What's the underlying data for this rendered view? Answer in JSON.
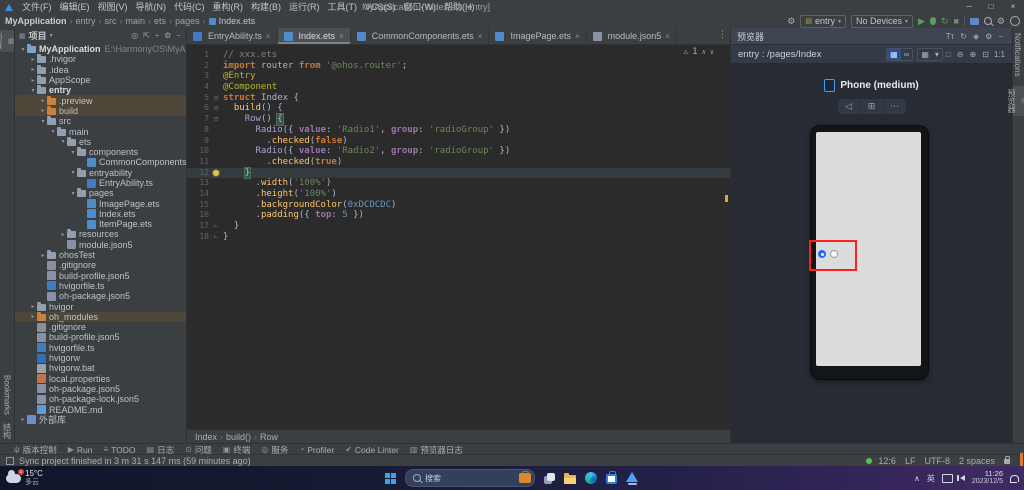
{
  "icons": {
    "min": "─",
    "max": "□",
    "close": "×",
    "settings": "⚙",
    "run": "▶",
    "stop": "■",
    "kebab": "⋮",
    "warning": "⚠",
    "up": "∧",
    "down": "∨",
    "caret": "▾",
    "locate": "◎",
    "collapse": "⇱",
    "divide": "÷",
    "hide": "−",
    "grid": "▦",
    "glasses": "∞"
  },
  "colors": {
    "run_green": "#57a05c",
    "warning_yellow": "#e8a33d",
    "selection_red": "#ff1f1f",
    "radio_checked_blue": "#1f69ff",
    "phone_screen_gray": "#dcdcdc",
    "editor_bg": "#2b2b2b"
  },
  "window": {
    "title": "MyApplication - Index.ets [entry]",
    "menus": [
      "文件(F)",
      "编辑(E)",
      "视图(V)",
      "导航(N)",
      "代码(C)",
      "重构(R)",
      "构建(B)",
      "运行(R)",
      "工具(T)",
      "VCS(S)",
      "窗口(W)",
      "帮助(H)"
    ]
  },
  "toolbar": {
    "breadcrumb": [
      "MyApplication",
      "entry",
      "src",
      "main",
      "ets",
      "pages",
      "Index.ets"
    ],
    "module": "entry",
    "devices": "No Devices"
  },
  "left_stripe": {
    "project": "项目",
    "bookmarks": "Bookmarks",
    "structure": "结构"
  },
  "right_stripe": {
    "notifications": "Notifications",
    "previewer": "预览器"
  },
  "project_panel": {
    "title": "项目",
    "tree": [
      [
        0,
        "v",
        "folder-root",
        "MyApplication",
        "E:\\HarmonyOS\\MyApplicatio",
        "b"
      ],
      [
        1,
        ">",
        "folder",
        ".hvigor",
        "",
        ""
      ],
      [
        1,
        ">",
        "folder",
        ".idea",
        "",
        ""
      ],
      [
        1,
        ">",
        "folder",
        "AppScope",
        "",
        ""
      ],
      [
        1,
        "v",
        "folder",
        "entry",
        "",
        "b"
      ],
      [
        2,
        ">",
        "folder-orange",
        ".preview",
        "",
        "h"
      ],
      [
        2,
        ">",
        "folder-orange",
        "build",
        "",
        "h"
      ],
      [
        2,
        "v",
        "folder",
        "src",
        "",
        ""
      ],
      [
        3,
        "v",
        "folder",
        "main",
        "",
        ""
      ],
      [
        4,
        "v",
        "folder",
        "ets",
        "",
        ""
      ],
      [
        5,
        "v",
        "folder",
        "components",
        "",
        ""
      ],
      [
        6,
        "",
        "ets",
        "CommonComponents.ets",
        "",
        ""
      ],
      [
        5,
        "v",
        "folder",
        "entryability",
        "",
        ""
      ],
      [
        6,
        "",
        "ts",
        "EntryAbility.ts",
        "",
        ""
      ],
      [
        5,
        "v",
        "folder",
        "pages",
        "",
        ""
      ],
      [
        6,
        "",
        "ets",
        "ImagePage.ets",
        "",
        ""
      ],
      [
        6,
        "",
        "ets",
        "Index.ets",
        "",
        ""
      ],
      [
        6,
        "",
        "ets",
        "ItemPage.ets",
        "",
        ""
      ],
      [
        4,
        ">",
        "folder",
        "resources",
        "",
        ""
      ],
      [
        4,
        "",
        "json",
        "module.json5",
        "",
        ""
      ],
      [
        2,
        ">",
        "folder",
        "ohosTest",
        "",
        ""
      ],
      [
        2,
        "",
        "git",
        ".gitignore",
        "",
        ""
      ],
      [
        2,
        "",
        "json",
        "build-profile.json5",
        "",
        ""
      ],
      [
        2,
        "",
        "ts",
        "hvigorfile.ts",
        "",
        ""
      ],
      [
        2,
        "",
        "json",
        "oh-package.json5",
        "",
        ""
      ],
      [
        1,
        ">",
        "folder",
        "hvigor",
        "",
        ""
      ],
      [
        1,
        ">",
        "folder-orange",
        "oh_modules",
        "",
        "h"
      ],
      [
        1,
        "",
        "git",
        ".gitignore",
        "",
        ""
      ],
      [
        1,
        "",
        "json",
        "build-profile.json5",
        "",
        ""
      ],
      [
        1,
        "",
        "ts",
        "hvigorfile.ts",
        "",
        ""
      ],
      [
        1,
        "",
        "file",
        "hvigorw",
        "",
        ""
      ],
      [
        1,
        "",
        "bat",
        "hvigorw.bat",
        "",
        ""
      ],
      [
        1,
        "",
        "props",
        "local.properties",
        "",
        ""
      ],
      [
        1,
        "",
        "json",
        "oh-package.json5",
        "",
        ""
      ],
      [
        1,
        "",
        "json",
        "oh-package-lock.json5",
        "",
        ""
      ],
      [
        1,
        "",
        "md",
        "README.md",
        "",
        ""
      ],
      [
        0,
        ">",
        "lib",
        "外部库",
        "",
        ""
      ]
    ]
  },
  "editor": {
    "tabs": [
      {
        "label": "EntryAbility.ts",
        "type": "ts",
        "active": false
      },
      {
        "label": "Index.ets",
        "type": "ets",
        "active": true
      },
      {
        "label": "CommonComponents.ets",
        "type": "ets",
        "active": false
      },
      {
        "label": "ImagePage.ets",
        "type": "ets",
        "active": false
      },
      {
        "label": "module.json5",
        "type": "json",
        "active": false
      }
    ],
    "warnings": "1",
    "breadcrumb": [
      "Index",
      "build()",
      "Row"
    ],
    "lines": [
      {
        "n": 1,
        "segs": [
          [
            "// xxx.ets",
            "cmt"
          ]
        ]
      },
      {
        "n": 2,
        "segs": [
          [
            "import ",
            "kw"
          ],
          [
            "router ",
            "txt"
          ],
          [
            "from ",
            "kw"
          ],
          [
            "'@ohos.router'",
            "str"
          ],
          [
            ";",
            "txt"
          ]
        ]
      },
      {
        "n": 3,
        "segs": [
          [
            "@Entry",
            "ann"
          ]
        ]
      },
      {
        "n": 4,
        "segs": [
          [
            "@Component",
            "ann"
          ]
        ]
      },
      {
        "n": 5,
        "fold": "s",
        "segs": [
          [
            "struct ",
            "kw"
          ],
          [
            "Index ",
            "txt"
          ],
          [
            "{",
            "txt"
          ]
        ]
      },
      {
        "n": 6,
        "fold": "s",
        "segs": [
          [
            "  ",
            "txt"
          ],
          [
            "build",
            "fn"
          ],
          [
            "() {",
            "txt"
          ]
        ]
      },
      {
        "n": 7,
        "fold": "s",
        "segs": [
          [
            "    ",
            "txt"
          ],
          [
            "Row",
            "cmp"
          ],
          [
            "() ",
            "txt"
          ],
          [
            "{",
            "brace"
          ]
        ]
      },
      {
        "n": 8,
        "segs": [
          [
            "      ",
            "txt"
          ],
          [
            "Radio",
            "cmp"
          ],
          [
            "({ ",
            "txt"
          ],
          [
            "value",
            "key"
          ],
          [
            ": ",
            "txt"
          ],
          [
            "'Radio1'",
            "str"
          ],
          [
            ", ",
            "txt"
          ],
          [
            "group",
            "key"
          ],
          [
            ": ",
            "txt"
          ],
          [
            "'radioGroup'",
            "str"
          ],
          [
            " })",
            "txt"
          ]
        ]
      },
      {
        "n": 9,
        "segs": [
          [
            "        .",
            "txt"
          ],
          [
            "checked",
            "fn"
          ],
          [
            "(",
            "txt"
          ],
          [
            "false",
            "kw"
          ],
          [
            ")",
            "txt"
          ]
        ]
      },
      {
        "n": 10,
        "segs": [
          [
            "      ",
            "txt"
          ],
          [
            "Radio",
            "cmp"
          ],
          [
            "({ ",
            "txt"
          ],
          [
            "value",
            "key"
          ],
          [
            ": ",
            "txt"
          ],
          [
            "'Radio2'",
            "str"
          ],
          [
            ", ",
            "txt"
          ],
          [
            "group",
            "key"
          ],
          [
            ": ",
            "txt"
          ],
          [
            "'radioGroup'",
            "str"
          ],
          [
            " })",
            "txt"
          ]
        ]
      },
      {
        "n": 11,
        "segs": [
          [
            "        .",
            "txt"
          ],
          [
            "checked",
            "fn"
          ],
          [
            "(",
            "txt"
          ],
          [
            "true",
            "kw"
          ],
          [
            ")",
            "txt"
          ]
        ]
      },
      {
        "n": 12,
        "hl": true,
        "bulb": true,
        "fold": "e",
        "segs": [
          [
            "    ",
            "txt"
          ],
          [
            "}",
            "brace"
          ]
        ]
      },
      {
        "n": 13,
        "segs": [
          [
            "      .",
            "txt"
          ],
          [
            "width",
            "fn"
          ],
          [
            "(",
            "txt"
          ],
          [
            "'100%'",
            "str"
          ],
          [
            ")",
            "txt"
          ]
        ]
      },
      {
        "n": 14,
        "segs": [
          [
            "      .",
            "txt"
          ],
          [
            "height",
            "fn"
          ],
          [
            "(",
            "txt"
          ],
          [
            "'100%'",
            "str"
          ],
          [
            ")",
            "txt"
          ]
        ]
      },
      {
        "n": 15,
        "segs": [
          [
            "      .",
            "txt"
          ],
          [
            "backgroundColor",
            "fn"
          ],
          [
            "(",
            "txt"
          ],
          [
            "0xDCDCDC",
            "num2"
          ],
          [
            ")",
            "txt"
          ]
        ]
      },
      {
        "n": 16,
        "segs": [
          [
            "      .",
            "txt"
          ],
          [
            "padding",
            "fn"
          ],
          [
            "({ ",
            "txt"
          ],
          [
            "top",
            "key"
          ],
          [
            ": ",
            "txt"
          ],
          [
            "5",
            "num2"
          ],
          [
            " })",
            "txt"
          ]
        ]
      },
      {
        "n": 17,
        "fold": "e",
        "segs": [
          [
            "  }",
            "txt"
          ]
        ]
      },
      {
        "n": 18,
        "fold": "e",
        "segs": [
          [
            "}",
            "txt"
          ]
        ]
      }
    ]
  },
  "previewer": {
    "title": "预览器",
    "header_icons": [
      "Tт",
      "↻",
      "◈",
      "⚙",
      "−"
    ],
    "target": "entry : /pages/Index",
    "tool_icons": [
      "□",
      "⊖",
      "⊕",
      "⊡"
    ],
    "ratio": "1:1",
    "device": "Phone (medium)",
    "device_controls": [
      "◁",
      "⊞",
      "⋯"
    ]
  },
  "bottom_bar": {
    "items": [
      {
        "glyph": "ψ",
        "label": "版本控制"
      },
      {
        "glyph": "▶",
        "label": "Run"
      },
      {
        "glyph": "≡",
        "label": "TODO"
      },
      {
        "glyph": "▤",
        "label": "日志"
      },
      {
        "glyph": "⊙",
        "label": "问题"
      },
      {
        "glyph": "▣",
        "label": "终端"
      },
      {
        "glyph": "◎",
        "label": "服务"
      },
      {
        "glyph": "◔",
        "label": "Profiler"
      },
      {
        "glyph": "✔",
        "label": "Code Linter"
      },
      {
        "glyph": "▥",
        "label": "预览器日志"
      }
    ]
  },
  "status_bar": {
    "sync": "Sync project finished in 3 m 31 s 147 ms (59 minutes ago)",
    "position": "12:6",
    "eol": "LF",
    "encoding": "UTF-8",
    "indent": "2 spaces"
  },
  "taskbar": {
    "weather_temp": "15°C",
    "weather_cond": "多云",
    "weather_badge": "1",
    "search": "搜索",
    "lang": "英",
    "time": "11:26",
    "date": "2023/12/5"
  }
}
